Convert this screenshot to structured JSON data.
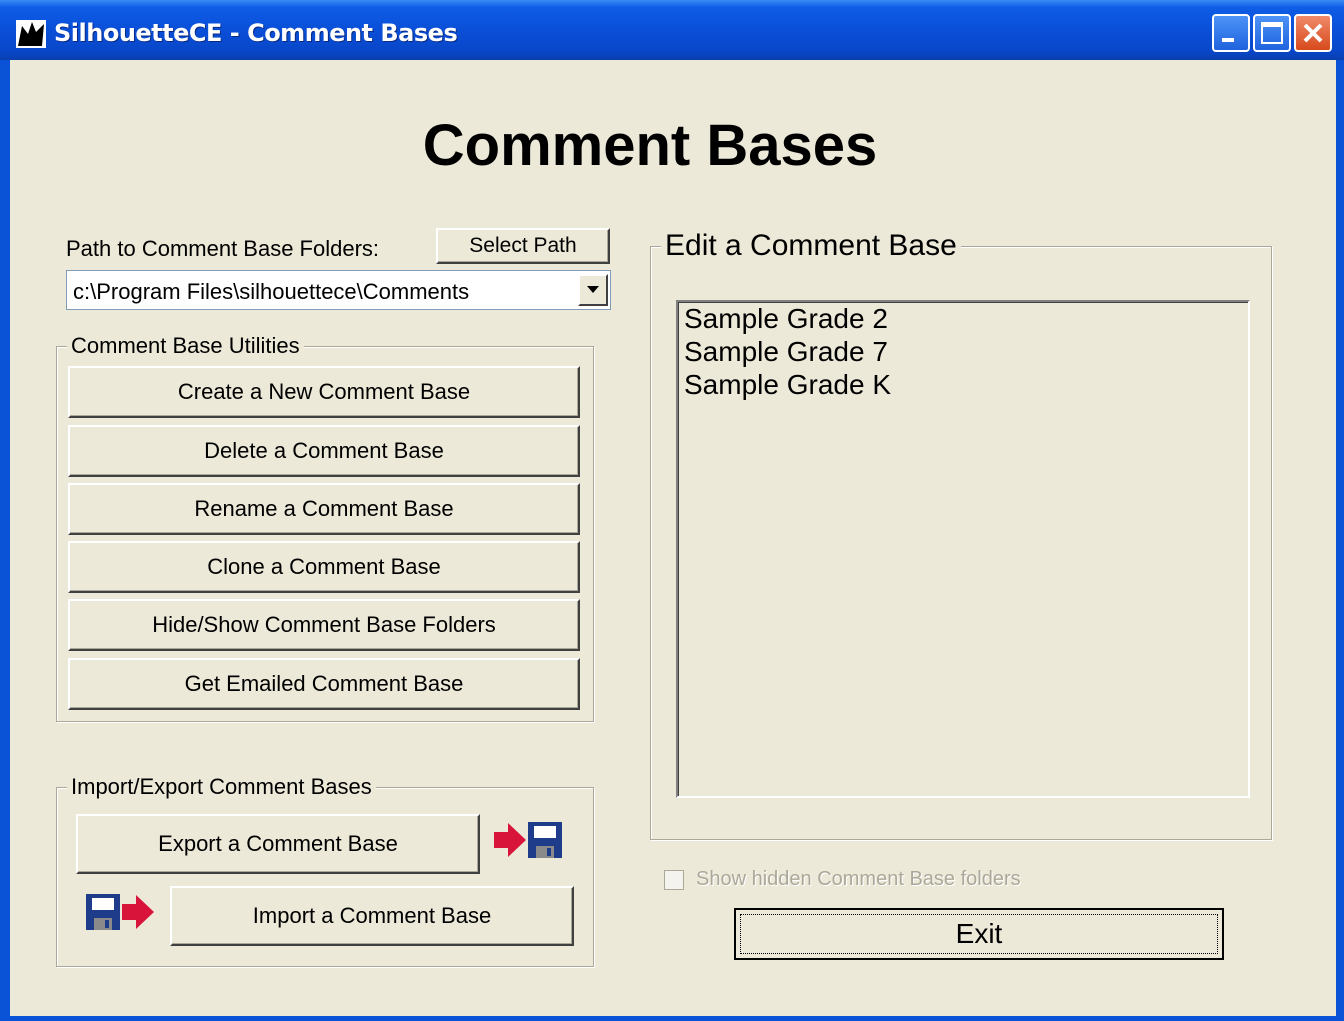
{
  "window": {
    "title": "SilhouetteCE - Comment Bases"
  },
  "page": {
    "heading": "Comment Bases"
  },
  "path": {
    "label": "Path to Comment Base Folders:",
    "select_button": "Select Path",
    "value": "c:\\Program Files\\silhouettece\\Comments"
  },
  "utilities": {
    "legend": "Comment Base Utilities",
    "buttons": [
      "Create a New Comment Base",
      "Delete a Comment Base",
      "Rename a Comment Base",
      "Clone a Comment Base",
      "Hide/Show Comment Base Folders",
      "Get Emailed Comment Base"
    ]
  },
  "import_export": {
    "legend": "Import/Export Comment Bases",
    "export_button": "Export a Comment Base",
    "import_button": "Import a Comment Base"
  },
  "edit": {
    "legend": "Edit a Comment Base",
    "items": [
      "Sample Grade 2",
      "Sample Grade 7",
      "Sample Grade K"
    ]
  },
  "show_hidden": {
    "label": "Show hidden Comment Base folders",
    "checked": false,
    "enabled": false
  },
  "exit_button": "Exit",
  "colors": {
    "titlebar": "#0a4fd8",
    "face": "#ece9d8",
    "arrow_red": "#d8143a",
    "disk_blue": "#1f3c8a"
  }
}
